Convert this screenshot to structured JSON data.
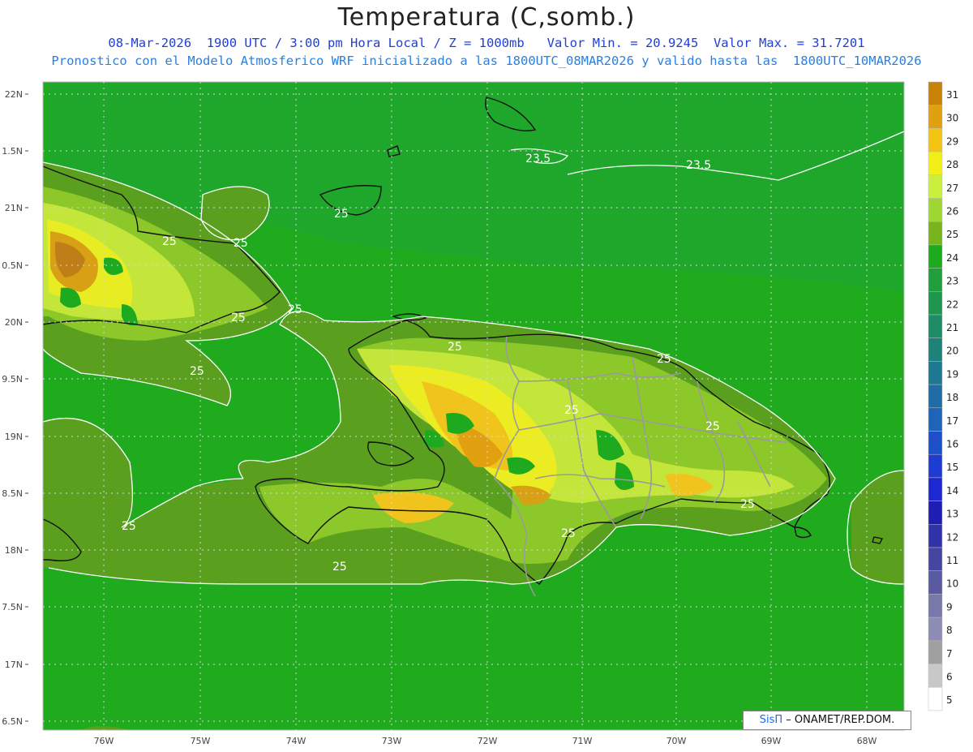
{
  "title": "Temperatura (C,somb.)",
  "subtitle_line1": "08-Mar-2026  1900 UTC / 3:00 pm Hora Local / Z = 1000mb   Valor Min. = 20.9245  Valor Max. = 31.7201",
  "subtitle_line2": "Pronostico con el Modelo Atmosferico WRF inicializado a las 1800UTC_08MAR2026 y valido hasta las  1800UTC_10MAR2026",
  "credit": {
    "brand": "SisΠ",
    "text": "– ONAMET/REP.DOM."
  },
  "lat_ticks": [
    "22N",
    "1.5N",
    "21N",
    "0.5N",
    "20N",
    "9.5N",
    "19N",
    "8.5N",
    "18N",
    "7.5N",
    "17N",
    "6.5N"
  ],
  "lon_ticks": [
    "76W",
    "75W",
    "74W",
    "73W",
    "72W",
    "71W",
    "70W",
    "69W",
    "68W"
  ],
  "colorbar_labels": [
    "31",
    "30",
    "29",
    "28",
    "27",
    "26",
    "25",
    "24",
    "23",
    "22",
    "21",
    "20",
    "19",
    "18",
    "17",
    "16",
    "15",
    "14",
    "13",
    "12",
    "11",
    "10",
    "9",
    "8",
    "7",
    "6",
    "5"
  ],
  "colorbar_colors": [
    "#c8820a",
    "#e0a010",
    "#f2c414",
    "#f0f018",
    "#c8f03c",
    "#a0d632",
    "#78b41e",
    "#1eaa1e",
    "#20a03c",
    "#1e9650",
    "#1e8c64",
    "#1e8278",
    "#1e7891",
    "#1e6ea5",
    "#1e64b9",
    "#1e50c8",
    "#1e3cd2",
    "#1e28d2",
    "#1e1eb4",
    "#3232aa",
    "#4646a0",
    "#5a5aa0",
    "#7878aa",
    "#8c8cb4",
    "#a0a0a0",
    "#c8c8c8",
    "#ffffff"
  ],
  "contour_labels": [
    "23.5",
    "23.5",
    "25",
    "25",
    "25",
    "25",
    "25",
    "25",
    "25",
    "25",
    "25",
    "25",
    "25",
    "25",
    "25",
    "25"
  ]
}
